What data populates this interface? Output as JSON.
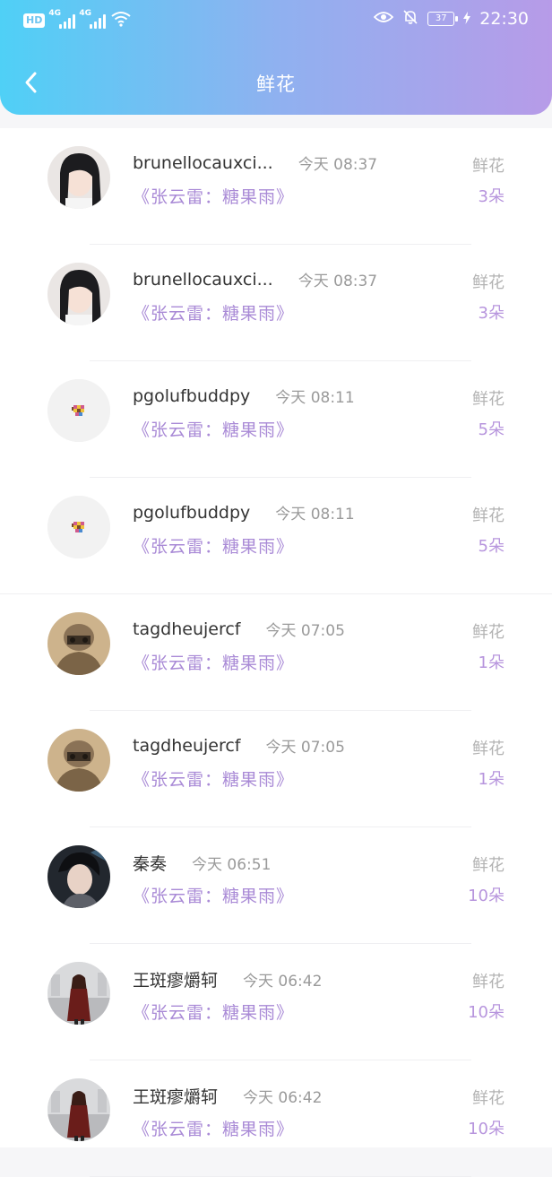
{
  "status_bar": {
    "hd": "HD",
    "sim1": "4G",
    "sim2": "4G",
    "battery": "37",
    "time": "22:30"
  },
  "header": {
    "title": "鲜花",
    "back_icon": "chevron-left-icon"
  },
  "items": [
    {
      "name": "brunellocauxci...",
      "time": "今天 08:37",
      "song": "《张云雷：糖果雨》",
      "gift": "鲜花",
      "count": "3朵",
      "avatar": "girl"
    },
    {
      "name": "brunellocauxci...",
      "time": "今天 08:37",
      "song": "《张云雷：糖果雨》",
      "gift": "鲜花",
      "count": "3朵",
      "avatar": "girl"
    },
    {
      "name": "pgolufbuddpy",
      "time": "今天 08:11",
      "song": "《张云雷：糖果雨》",
      "gift": "鲜花",
      "count": "5朵",
      "avatar": "pixel"
    },
    {
      "name": "pgolufbuddpy",
      "time": "今天 08:11",
      "song": "《张云雷：糖果雨》",
      "gift": "鲜花",
      "count": "5朵",
      "avatar": "pixel"
    },
    {
      "name": "tagdheujercf",
      "time": "今天 07:05",
      "song": "《张云雷：糖果雨》",
      "gift": "鲜花",
      "count": "1朵",
      "avatar": "soldier"
    },
    {
      "name": "tagdheujercf",
      "time": "今天 07:05",
      "song": "《张云雷：糖果雨》",
      "gift": "鲜花",
      "count": "1朵",
      "avatar": "soldier"
    },
    {
      "name": "秦奏",
      "time": "今天 06:51",
      "song": "《张云雷：糖果雨》",
      "gift": "鲜花",
      "count": "10朵",
      "avatar": "man"
    },
    {
      "name": "王斑瘳爝轲",
      "time": "今天 06:42",
      "song": "《张云雷：糖果雨》",
      "gift": "鲜花",
      "count": "10朵",
      "avatar": "woman-street"
    },
    {
      "name": "王斑瘳爝轲",
      "time": "今天 06:42",
      "song": "《张云雷：糖果雨》",
      "gift": "鲜花",
      "count": "10朵",
      "avatar": "woman-street"
    }
  ]
}
